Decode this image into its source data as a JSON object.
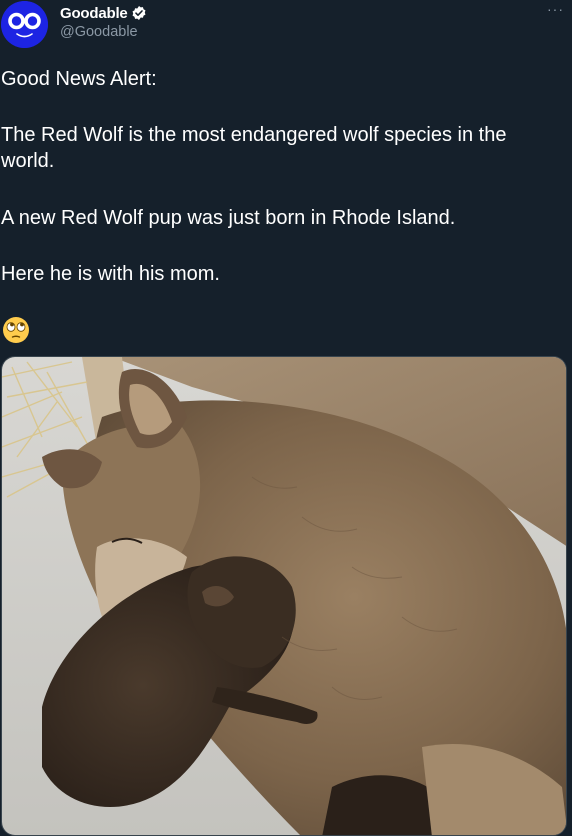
{
  "author": {
    "display_name": "Goodable",
    "handle": "@Goodable",
    "verified": true,
    "avatar_icon": "goodable-logo-icon",
    "avatar_color": "#1d24e3"
  },
  "more_label": "···",
  "tweet": {
    "line1": "Good News Alert:",
    "line2": "The Red Wolf is the most endangered wolf species in the world.",
    "line3": "A new Red Wolf pup was just born in Rhode Island.",
    "line4": "Here he is with his mom.",
    "emoji_icon": "face-with-rolling-eyes-icon"
  },
  "media": {
    "photo_icon": "wolf-and-pup-photo"
  },
  "colors": {
    "background": "#15202b",
    "text": "#ffffff",
    "secondary_text": "#8b98a5",
    "verified_badge": "#ffffff"
  }
}
